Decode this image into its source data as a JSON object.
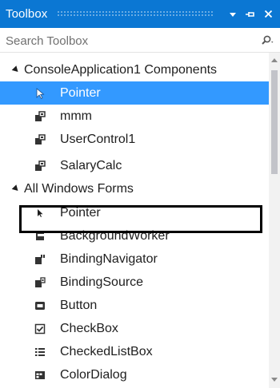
{
  "window": {
    "title": "Toolbox",
    "accent_color": "#0b77d3",
    "buttons": {
      "dropdown_icon": "chevron-down-icon",
      "pin_icon": "pin-icon",
      "close_icon": "close-icon"
    }
  },
  "search": {
    "placeholder": "Search Toolbox",
    "value": "",
    "icon": "search-icon"
  },
  "tree": {
    "selection_color": "#3399ff",
    "groups": [
      {
        "label": "ConsoleApplication1 Components",
        "expanded": true,
        "items": [
          {
            "label": "Pointer",
            "icon": "pointer-icon",
            "selected": true
          },
          {
            "label": "mmm",
            "icon": "component-icon",
            "selected": false
          },
          {
            "label": "UserControl1",
            "icon": "component-icon",
            "selected": false
          },
          {
            "label": "SalaryCalc",
            "icon": "component-icon",
            "selected": false,
            "highlighted": true
          }
        ]
      },
      {
        "label": "All Windows Forms",
        "expanded": true,
        "items": [
          {
            "label": "Pointer",
            "icon": "pointer-icon"
          },
          {
            "label": "BackgroundWorker",
            "icon": "background-worker-icon"
          },
          {
            "label": "BindingNavigator",
            "icon": "binding-navigator-icon"
          },
          {
            "label": "BindingSource",
            "icon": "binding-source-icon"
          },
          {
            "label": "Button",
            "icon": "button-icon"
          },
          {
            "label": "CheckBox",
            "icon": "checkbox-icon"
          },
          {
            "label": "CheckedListBox",
            "icon": "checked-list-box-icon"
          },
          {
            "label": "ColorDialog",
            "icon": "color-dialog-icon"
          }
        ]
      }
    ]
  }
}
